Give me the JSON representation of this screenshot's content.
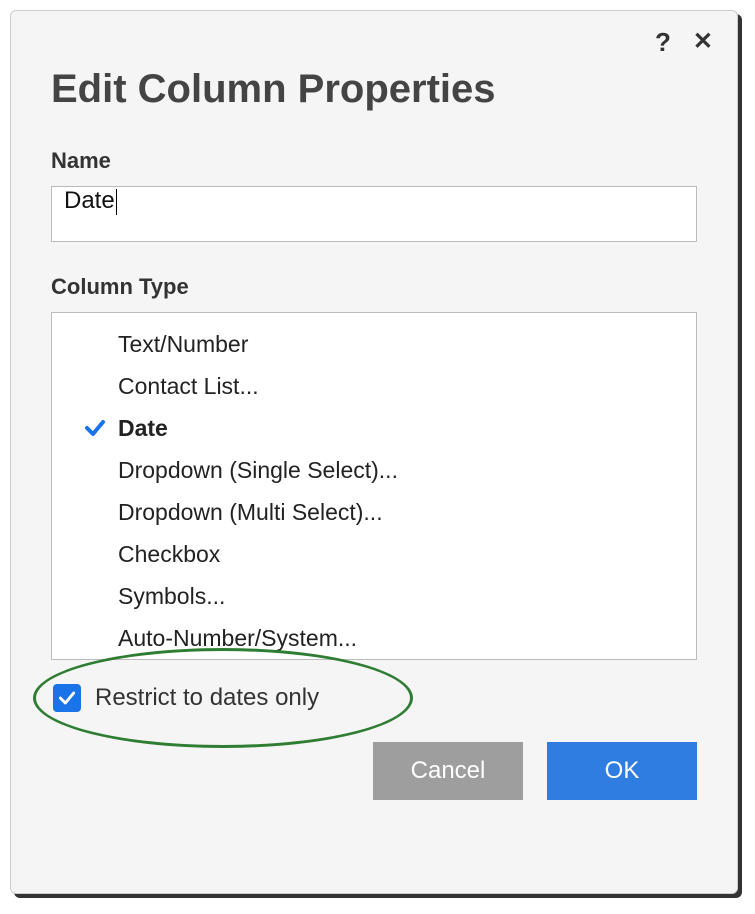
{
  "dialog": {
    "title": "Edit Column Properties",
    "name_label": "Name",
    "name_value": "Date",
    "type_label": "Column Type",
    "types": [
      "Text/Number",
      "Contact List...",
      "Date",
      "Dropdown (Single Select)...",
      "Dropdown (Multi Select)...",
      "Checkbox",
      "Symbols...",
      "Auto-Number/System..."
    ],
    "selected_index": 2,
    "restrict_label": "Restrict to dates only",
    "restrict_checked": true,
    "cancel": "Cancel",
    "ok": "OK"
  }
}
